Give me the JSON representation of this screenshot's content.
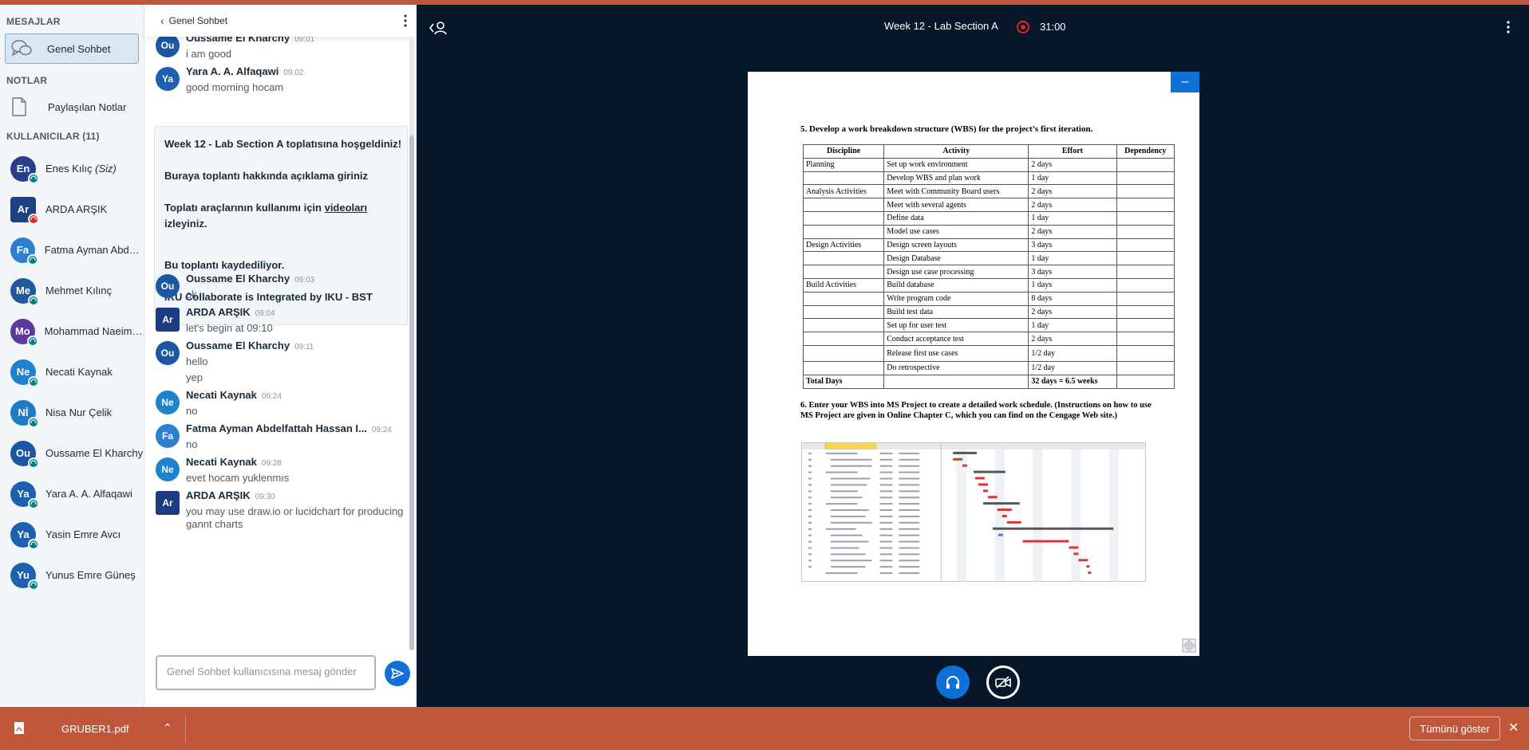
{
  "sidebar": {
    "messages_header": "MESAJLAR",
    "public_chat": "Genel Sohbet",
    "notes_header": "NOTLAR",
    "shared_notes": "Paylaşılan Notlar",
    "users_header": "KULLANICILAR (11)",
    "users": [
      {
        "initials": "En",
        "name": "Enes Kılıç",
        "suffix": "(Siz)",
        "color": "#2a3e88",
        "mic": "teal"
      },
      {
        "initials": "Ar",
        "name": "ARDA ARŞIK",
        "suffix": "",
        "color": "#1d4284",
        "mic": "red"
      },
      {
        "initials": "Fa",
        "name": "Fatma Ayman Abdelf...",
        "suffix": "",
        "color": "#2f7fd0",
        "mic": "teal"
      },
      {
        "initials": "Me",
        "name": "Mehmet Kılınç",
        "suffix": "",
        "color": "#215a9c",
        "mic": "teal"
      },
      {
        "initials": "Mo",
        "name": "Mohammad Naeim F...",
        "suffix": "",
        "color": "#5b3a9c",
        "mic": "teal"
      },
      {
        "initials": "Ne",
        "name": "Necati Kaynak",
        "suffix": "",
        "color": "#1e82cd",
        "mic": "teal"
      },
      {
        "initials": "Nİ",
        "name": "Nisa Nur Çelik",
        "suffix": "",
        "color": "#1e7cc6",
        "mic": "teal"
      },
      {
        "initials": "Ou",
        "name": "Oussame El Kharchy",
        "suffix": "",
        "color": "#1b57a3",
        "mic": "teal"
      },
      {
        "initials": "Ya",
        "name": "Yara A. A. Alfaqawi",
        "suffix": "",
        "color": "#1d60b0",
        "mic": "teal"
      },
      {
        "initials": "Ya",
        "name": "Yasin Emre Avcı",
        "suffix": "",
        "color": "#1d60b0",
        "mic": "teal"
      },
      {
        "initials": "Yu",
        "name": "Yunus Emre Güneş",
        "suffix": "",
        "color": "#1d60b0",
        "mic": "teal"
      }
    ]
  },
  "chat": {
    "header_title": "Genel Sohbet",
    "messages": [
      {
        "initials": "Ou",
        "name": "Oussame El Kharchy",
        "time": "09:01",
        "lines": [
          "i am good"
        ],
        "color": "#1b57a3"
      },
      {
        "initials": "Ya",
        "name": "Yara A. A. Alfaqawi",
        "time": "09:02",
        "lines": [
          "good morning hocam"
        ],
        "color": "#1d60b0"
      },
      {
        "initials": "Ou",
        "name": "Oussame El Kharchy",
        "time": "09:03",
        "lines": [
          "ok"
        ],
        "color": "#1b57a3"
      },
      {
        "initials": "Ar",
        "name": "ARDA ARŞIK",
        "time": "09:04",
        "lines": [
          "let's begin at 09:10"
        ],
        "color": "#1d3b82"
      },
      {
        "initials": "Ou",
        "name": "Oussame El Kharchy",
        "time": "09:11",
        "lines": [
          "hello",
          "yep"
        ],
        "color": "#1b57a3"
      },
      {
        "initials": "Ne",
        "name": "Necati Kaynak",
        "time": "09:24",
        "lines": [
          "no"
        ],
        "color": "#1e82cd"
      },
      {
        "initials": "Fa",
        "name": "Fatma Ayman Abdelfattah Hassan I...",
        "time": "09:24",
        "lines": [
          "no"
        ],
        "color": "#2f7fd0"
      },
      {
        "initials": "Ne",
        "name": "Necati Kaynak",
        "time": "09:28",
        "lines": [
          "evet hocam yuklenmıs"
        ],
        "color": "#1e82cd"
      },
      {
        "initials": "Ar",
        "name": "ARDA ARŞIK",
        "time": "09:30",
        "lines": [
          "you may use draw.io or lucidchart for producing",
          "gannt charts"
        ],
        "color": "#1d3b82"
      }
    ],
    "welcome": {
      "line1": "Week 12 - Lab Section A toplatısına hoşgeldiniz!",
      "line2": "Buraya toplantı hakkında açıklama giriniz",
      "line3_pre": "Toplatı araçlarının kullanımı için ",
      "line3_link": "videoları",
      "line3_post": "izleyiniz.",
      "line4": "Bu toplantı kaydediliyor.",
      "line5": "IKU Collaborate is Integrated by IKU - BST"
    },
    "composer_placeholder": "Genel Sohbet kullanıcısına mesaj gönder"
  },
  "presentation": {
    "title": "Week 12 - Lab Section A",
    "record_time": "31:00",
    "minimize_label": "–",
    "slide": {
      "heading5": "5. Develop a work breakdown structure (WBS) for the project’s first iteration.",
      "columns": [
        "Discipline",
        "Activity",
        "Effort",
        "Dependency"
      ],
      "rows": [
        [
          "Planning",
          "Set up work environment",
          "2 days",
          ""
        ],
        [
          "",
          "Develop WBS and plan work",
          "1 day",
          ""
        ],
        [
          "Analysis Activities",
          "Meet with Community Board users",
          "2 days",
          ""
        ],
        [
          "",
          "Meet with several agents",
          "2 days",
          ""
        ],
        [
          "",
          "Define data",
          "1 day",
          ""
        ],
        [
          "",
          "Model use cases",
          "2 days",
          ""
        ],
        [
          "Design Activities",
          "Design screen layouts",
          "3 days",
          ""
        ],
        [
          "",
          "Design Database",
          "1 day",
          ""
        ],
        [
          "",
          "Design use case processing",
          "3 days",
          ""
        ],
        [
          "Build Activities",
          "Build database",
          "1 days",
          ""
        ],
        [
          "",
          "Write program code",
          "8 days",
          ""
        ],
        [
          "",
          "Build test data",
          "2 days",
          ""
        ],
        [
          "",
          "Set up for user test",
          "1 day",
          ""
        ],
        [
          "",
          "Conduct acceptance test",
          "2 days",
          ""
        ],
        [
          "",
          "Release first use cases",
          "1/2 day",
          ""
        ],
        [
          "",
          "Do retrospective",
          "1/2 day",
          ""
        ]
      ],
      "total_label": "Total Days",
      "total_value": "32 days = 6.5 weeks",
      "heading6": "6. Enter your WBS into MS Project to create a detailed work schedule. (Instructions on how to use MS Project are given in Online Chapter C, which you can find on the Cengage Web site.)"
    }
  },
  "downloads": {
    "file_name": "GRUBER1.pdf",
    "show_all": "Tümünü göster"
  }
}
